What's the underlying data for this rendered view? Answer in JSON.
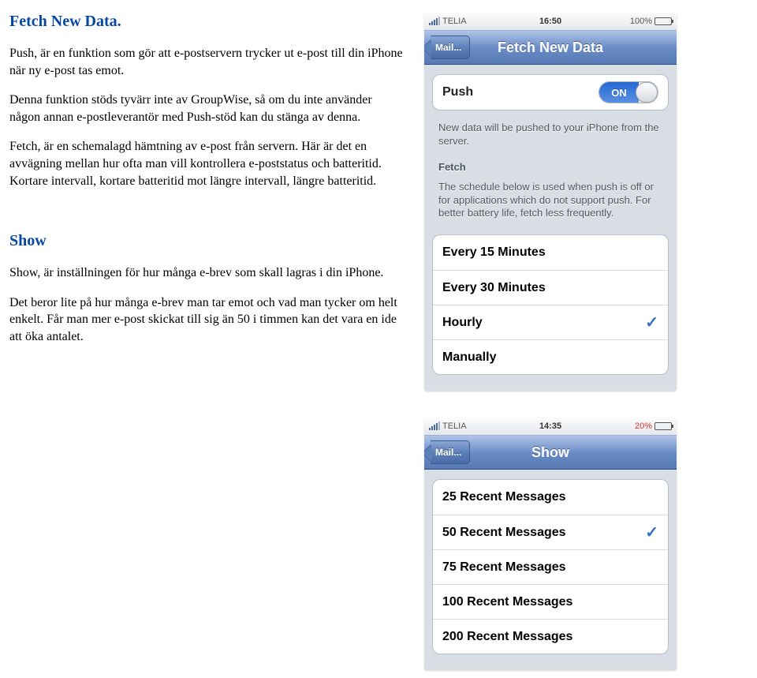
{
  "doc": {
    "section_fetch_title": "Fetch New Data.",
    "fetch_p1": "Push, är en funktion som gör att e-postservern trycker ut e-post till din iPhone när ny e-post tas emot.",
    "fetch_p2": "Denna funktion stöds tyvärr inte av GroupWise, så om du inte använder någon annan e-postleverantör med Push-stöd kan du stänga av denna.",
    "fetch_p3": "Fetch, är en schemalagd hämtning av e-post från servern. Här är det en avvägning mellan hur ofta man vill kontrollera e-poststatus och batteritid. Kortare intervall, kortare batteritid mot längre intervall, längre batteritid.",
    "section_show_title": "Show",
    "show_p1": "Show, är inställningen för hur många e-brev som skall lagras i din iPhone.",
    "show_p2": "Det beror lite på hur många e-brev man tar emot och vad man tycker om helt enkelt. Får man mer e-post skickat till sig än 50 i timmen kan det vara en ide att öka antalet."
  },
  "phone_fetch": {
    "status": {
      "carrier": "TELIA",
      "time": "16:50",
      "battery_pct": "100%",
      "battery_low": false
    },
    "nav": {
      "back": "Mail...",
      "title": "Fetch New Data"
    },
    "push": {
      "label": "Push",
      "toggle_label": "ON",
      "hint": "New data will be pushed to your iPhone from the server."
    },
    "fetch_header": "Fetch",
    "fetch_hint": "The schedule below is used when push is off or for applications which do not support push. For better battery life, fetch less frequently.",
    "options": [
      {
        "label": "Every 15 Minutes",
        "selected": false
      },
      {
        "label": "Every 30 Minutes",
        "selected": false
      },
      {
        "label": "Hourly",
        "selected": true
      },
      {
        "label": "Manually",
        "selected": false
      }
    ]
  },
  "phone_show": {
    "status": {
      "carrier": "TELIA",
      "time": "14:35",
      "battery_pct": "20%",
      "battery_low": true
    },
    "nav": {
      "back": "Mail...",
      "title": "Show"
    },
    "options": [
      {
        "label": "25 Recent Messages",
        "selected": false
      },
      {
        "label": "50 Recent Messages",
        "selected": true
      },
      {
        "label": "75 Recent Messages",
        "selected": false
      },
      {
        "label": "100 Recent Messages",
        "selected": false
      },
      {
        "label": "200 Recent Messages",
        "selected": false
      }
    ]
  }
}
